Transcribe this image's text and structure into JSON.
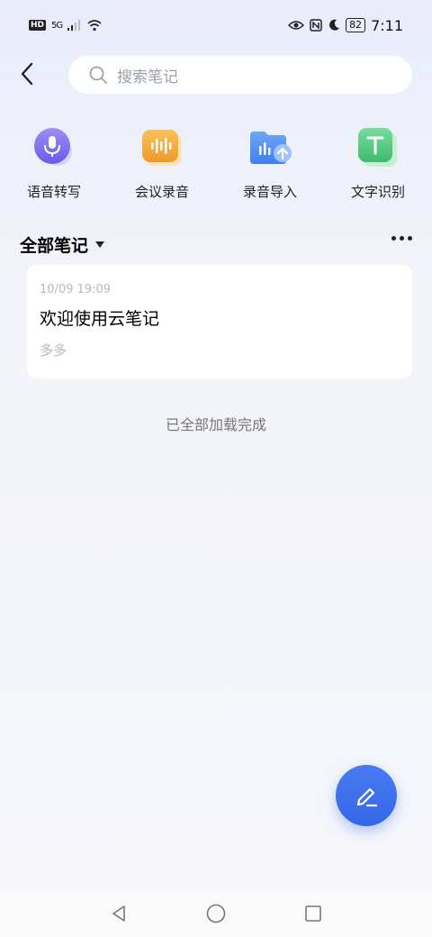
{
  "status_bar": {
    "left_badge": "HD",
    "network": "5G",
    "battery": "82",
    "time": "7:11"
  },
  "search": {
    "placeholder": "搜索笔记"
  },
  "quick_actions": [
    {
      "label": "语音转写",
      "icon": "mic-icon",
      "color": "#7b6cf0"
    },
    {
      "label": "会议录音",
      "icon": "waveform-icon",
      "color": "#f0a63a"
    },
    {
      "label": "录音导入",
      "icon": "folder-upload-icon",
      "color": "#4f8ff0"
    },
    {
      "label": "文字识别",
      "icon": "text-recognition-icon",
      "color": "#4cc27a"
    }
  ],
  "section": {
    "title": "全部笔记"
  },
  "notes": [
    {
      "date": "10/09 19:09",
      "title": "欢迎使用云笔记",
      "body": "多多"
    }
  ],
  "load_status": "已全部加载完成",
  "colors": {
    "accent": "#3566e6",
    "highlight": "#39e81f"
  }
}
